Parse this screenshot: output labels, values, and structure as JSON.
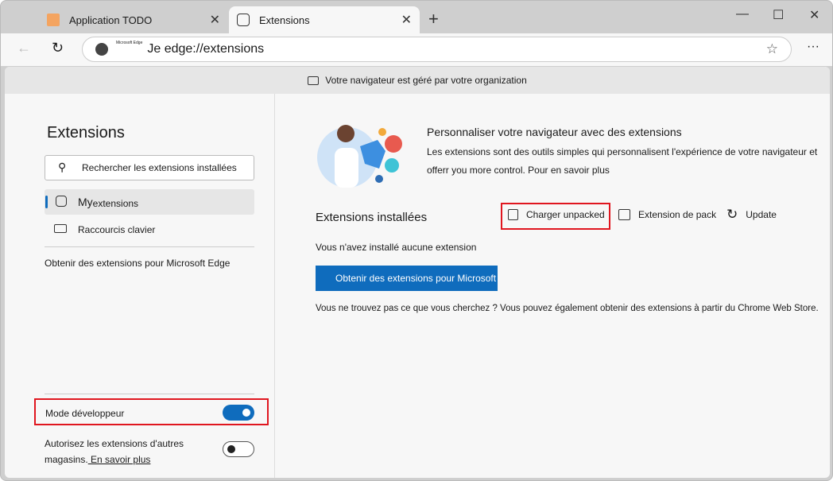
{
  "tabs": [
    {
      "label": "Application TODO"
    },
    {
      "label": "Extensions"
    }
  ],
  "address": {
    "prefix": "Microsoft Edge",
    "url": "Je edge://extensions"
  },
  "banner": "Votre navigateur est géré par votre organization",
  "sidebar": {
    "title": "Extensions",
    "search_placeholder": "Rechercher les extensions installées",
    "items": [
      {
        "label_a": "My",
        "label_b": " extensions"
      },
      {
        "label": "Raccourcis clavier"
      }
    ],
    "get_link": "Obtenir des extensions pour Microsoft Edge",
    "dev_mode": "Mode développeur",
    "dev_mode_on": true,
    "allow_other": "Autorisez les extensions d'autres magasins.",
    "learn_more": " En savoir plus",
    "allow_other_on": false
  },
  "main": {
    "promo_title": "Personnaliser votre navigateur avec des extensions",
    "promo_text": "Les extensions sont des outils simples qui personnalisent l'expérience de votre navigateur et offerr you more control. Pour en savoir plus",
    "installed_title": "Extensions installées",
    "load_unpacked": "Charger unpacked",
    "pack": "Extension de pack",
    "update": "Update",
    "none": "Vous n'avez installé aucune extension",
    "get_button": "Obtenir des extensions pour Microsoft Edge",
    "store_text": "Vous ne trouvez pas ce que vous cherchez ? Vous pouvez également obtenir des extensions à partir du Chrome Web Store."
  }
}
